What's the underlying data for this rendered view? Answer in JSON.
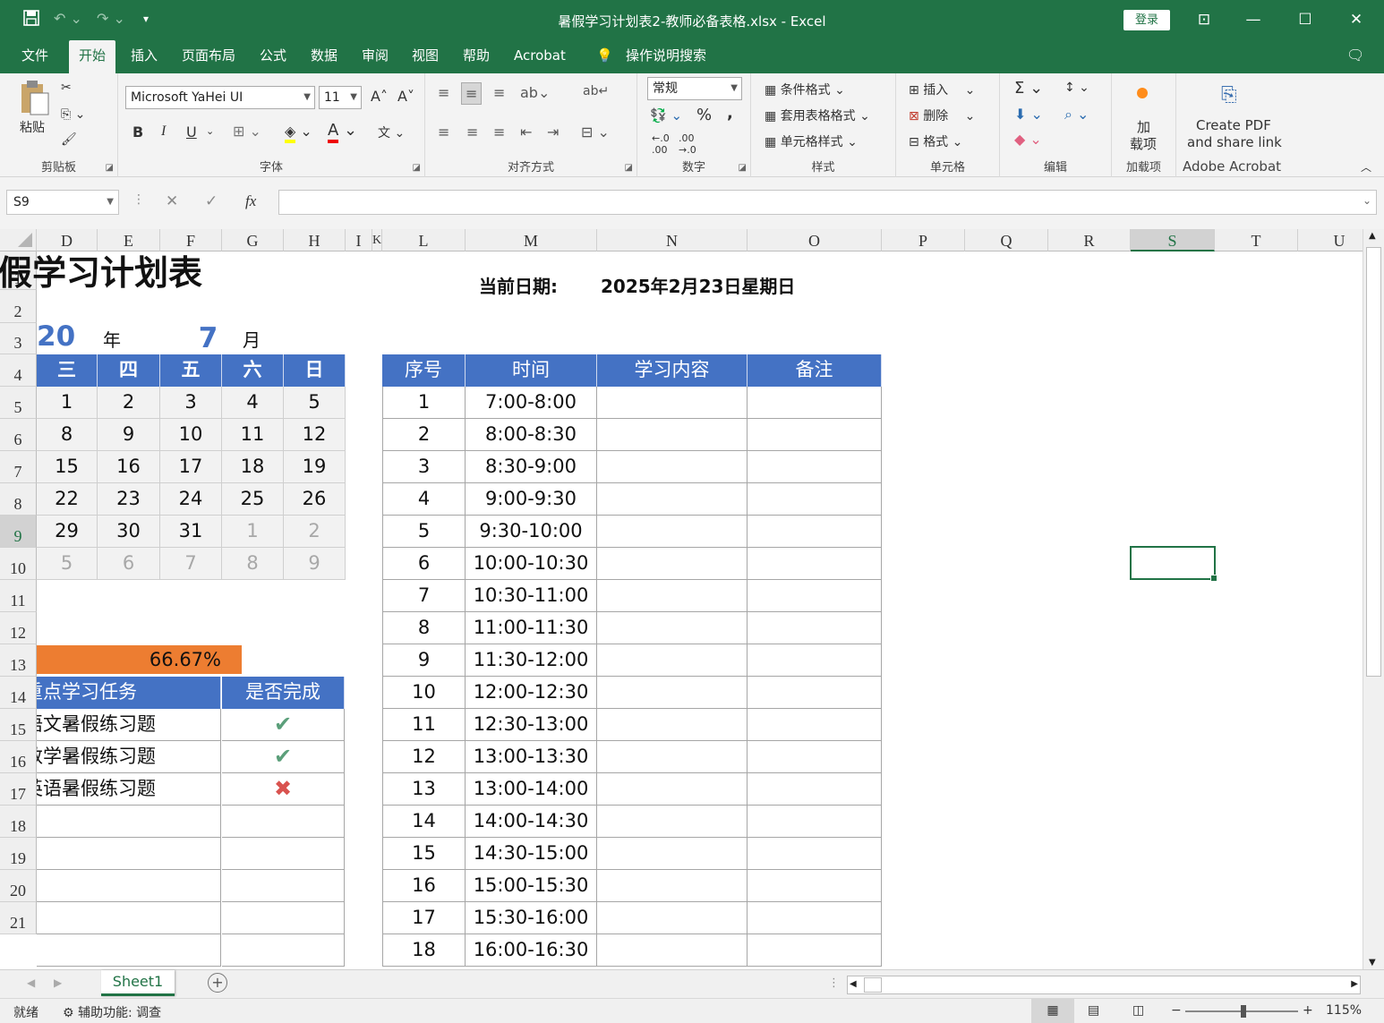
{
  "window": {
    "title": "暑假学习计划表2-教师必备表格.xlsx  -  Excel",
    "login": "登录"
  },
  "icons": {
    "save": "save-icon",
    "undo": "undo-icon",
    "redo": "redo-icon",
    "lightbulb": "lightbulb-icon"
  },
  "tabs": [
    "文件",
    "开始",
    "插入",
    "页面布局",
    "公式",
    "数据",
    "审阅",
    "视图",
    "帮助",
    "Acrobat"
  ],
  "tell_me": "操作说明搜索",
  "ribbon": {
    "clipboard": {
      "paste": "粘贴",
      "label": "剪贴板"
    },
    "font": {
      "name": "Microsoft YaHei UI",
      "size": "11",
      "label": "字体",
      "bold": "B",
      "italic": "I",
      "underline": "U"
    },
    "alignment": {
      "label": "对齐方式"
    },
    "number": {
      "format": "常规",
      "percent": "%",
      "comma": ",",
      "label": "数字"
    },
    "styles": {
      "cond": "条件格式",
      "table": "套用表格格式",
      "cell": "单元格样式",
      "label": "样式"
    },
    "cells": {
      "insert": "插入",
      "delete": "删除",
      "format": "格式",
      "label": "单元格"
    },
    "editing": {
      "label": "编辑"
    },
    "addins": {
      "btn1": "加",
      "btn2": "载项",
      "label": "加载项"
    },
    "acrobat": {
      "line1": "Create PDF",
      "line2": "and share link",
      "label": "Adobe Acrobat"
    }
  },
  "formula_bar": {
    "namebox": "S9",
    "fx": "fx",
    "value": ""
  },
  "columns": [
    "D",
    "E",
    "F",
    "G",
    "H",
    "I",
    "K",
    "L",
    "M",
    "N",
    "O",
    "P",
    "Q",
    "R",
    "S",
    "T",
    "U"
  ],
  "rows": [
    "1",
    "2",
    "3",
    "4",
    "5",
    "6",
    "7",
    "8",
    "9",
    "10",
    "11",
    "12",
    "13",
    "14",
    "15",
    "16",
    "17",
    "18",
    "19",
    "20",
    "21"
  ],
  "sheet": {
    "title": "暑假学习计划表",
    "current_date_label": "当前日期:",
    "current_date": "2025年2月23日星期日",
    "year_val": "20",
    "year_label": "年",
    "month_val": "7",
    "month_label": "月",
    "weekdays": [
      "三",
      "四",
      "五",
      "六",
      "日"
    ],
    "calendar": [
      [
        "1",
        "2",
        "3",
        "4",
        "5"
      ],
      [
        "8",
        "9",
        "10",
        "11",
        "12"
      ],
      [
        "15",
        "16",
        "17",
        "18",
        "19"
      ],
      [
        "22",
        "23",
        "24",
        "25",
        "26"
      ],
      [
        "29",
        "30",
        "31",
        "1",
        "2"
      ],
      [
        "5",
        "6",
        "7",
        "8",
        "9"
      ]
    ],
    "progress": "66.67%",
    "progress_fraction": 0.6667,
    "task_headers": [
      "重点学习任务",
      "是否完成"
    ],
    "tasks": [
      {
        "name": "语文暑假练习题",
        "done": true
      },
      {
        "name": "数学暑假练习题",
        "done": true
      },
      {
        "name": "英语暑假练习题",
        "done": false
      }
    ],
    "schedule_headers": [
      "序号",
      "时间",
      "学习内容",
      "备注"
    ],
    "schedule": [
      [
        "1",
        "7:00-8:00"
      ],
      [
        "2",
        "8:00-8:30"
      ],
      [
        "3",
        "8:30-9:00"
      ],
      [
        "4",
        "9:00-9:30"
      ],
      [
        "5",
        "9:30-10:00"
      ],
      [
        "6",
        "10:00-10:30"
      ],
      [
        "7",
        "10:30-11:00"
      ],
      [
        "8",
        "11:00-11:30"
      ],
      [
        "9",
        "11:30-12:00"
      ],
      [
        "10",
        "12:00-12:30"
      ],
      [
        "11",
        "12:30-13:00"
      ],
      [
        "12",
        "13:00-13:30"
      ],
      [
        "13",
        "13:00-14:00"
      ],
      [
        "14",
        "14:00-14:30"
      ],
      [
        "15",
        "14:30-15:00"
      ],
      [
        "16",
        "15:00-15:30"
      ],
      [
        "17",
        "15:30-16:00"
      ],
      [
        "18",
        "16:00-16:30"
      ]
    ]
  },
  "sheet_tab": "Sheet1",
  "status": {
    "ready": "就绪",
    "accessibility": "辅助功能: 调查",
    "zoom": "115%"
  }
}
